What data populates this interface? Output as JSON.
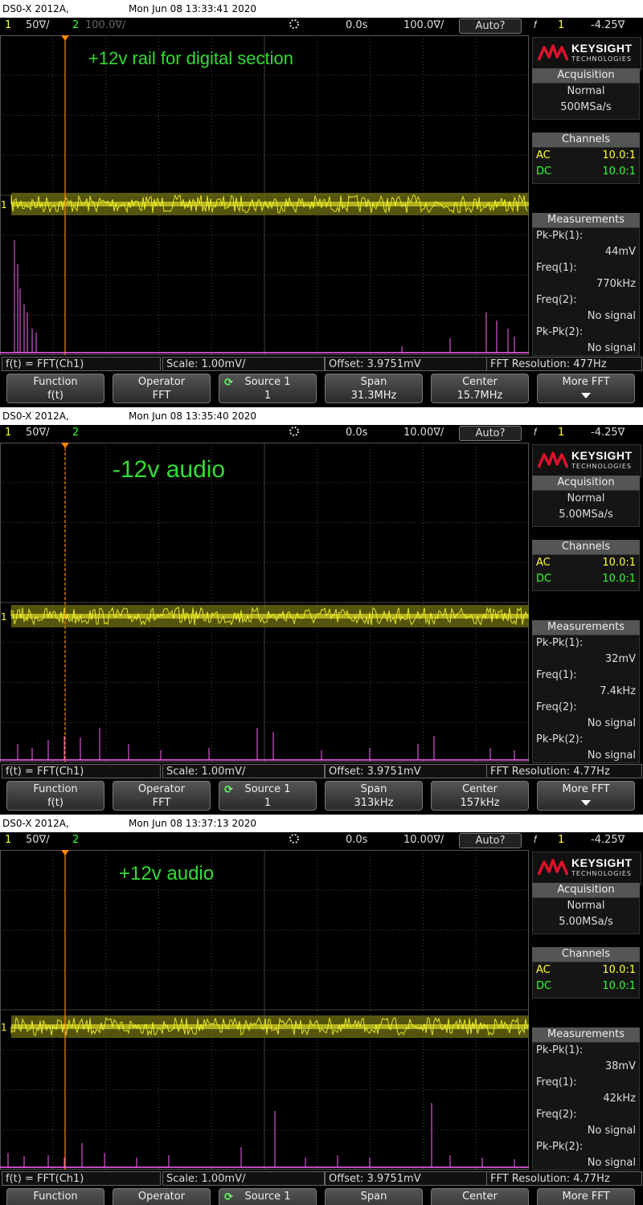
{
  "screens": [
    {
      "title_left": "DS0-X 2012A,",
      "title_date": "Mon Jun 08 13:33:41 2020",
      "ch1_num": "1",
      "ch1_scale": "50∇/",
      "ch2_num": "2",
      "ch2_scale": "100.0∇/",
      "time_delay": "0.0s",
      "time_scale": "100.0∇/",
      "trigger_mode": "Auto?",
      "trigger_src": "1",
      "trigger_level": "-4.25∇",
      "annotation": "+12v rail for digital section",
      "logo": {
        "name": "KEYSIGHT",
        "sub": "TECHNOLOGIES"
      },
      "acquisition": {
        "header": "Acquisition",
        "mode": "Normal",
        "rate": "500MSa/s"
      },
      "channels": {
        "header": "Channels",
        "ac_label": "AC",
        "ac_value": "10.0:1",
        "dc_label": "DC",
        "dc_value": "10.0:1"
      },
      "measurements": {
        "header": "Measurements",
        "items": [
          {
            "label": "Pk-Pk(1):",
            "value": "44mV"
          },
          {
            "label": "Freq(1):",
            "value": "770kHz"
          },
          {
            "label": "Freq(2):",
            "value": "No signal"
          },
          {
            "label": "Pk-Pk(2):",
            "value": "No signal"
          }
        ]
      },
      "info": {
        "func": "f(t) = FFT(Ch1)",
        "scale": "Scale: 1.00mV/",
        "offset": "Offset: 3.9751mV",
        "res": "FFT Resolution: 477Hz"
      },
      "softkeys": [
        {
          "title": "Function",
          "value": "f(t)"
        },
        {
          "title": "Operator",
          "value": "FFT"
        },
        {
          "title": "Source 1",
          "value": "1"
        },
        {
          "title": "Span",
          "value": "31.3MHz"
        },
        {
          "title": "Center",
          "value": "15.7MHz"
        },
        {
          "title": "More FFT",
          "value": ""
        }
      ]
    },
    {
      "title_left": "DS0-X 2012A,",
      "title_date": "Mon Jun 08 13:35:40 2020",
      "ch1_num": "1",
      "ch1_scale": "50∇/",
      "ch2_num": "2",
      "ch2_scale": "",
      "time_delay": "0.0s",
      "time_scale": "10.00∇/",
      "trigger_mode": "Auto?",
      "trigger_src": "1",
      "trigger_level": "-4.25∇",
      "annotation": "-12v audio",
      "logo": {
        "name": "KEYSIGHT",
        "sub": "TECHNOLOGIES"
      },
      "acquisition": {
        "header": "Acquisition",
        "mode": "Normal",
        "rate": "5.00MSa/s"
      },
      "channels": {
        "header": "Channels",
        "ac_label": "AC",
        "ac_value": "10.0:1",
        "dc_label": "DC",
        "dc_value": "10.0:1"
      },
      "measurements": {
        "header": "Measurements",
        "items": [
          {
            "label": "Pk-Pk(1):",
            "value": "32mV"
          },
          {
            "label": "Freq(1):",
            "value": "7.4kHz"
          },
          {
            "label": "Freq(2):",
            "value": "No signal"
          },
          {
            "label": "Pk-Pk(2):",
            "value": "No signal"
          }
        ]
      },
      "info": {
        "func": "f(t) = FFT(Ch1)",
        "scale": "Scale: 1.00mV/",
        "offset": "Offset: 3.9751mV",
        "res": "FFT Resolution: 4.77Hz"
      },
      "softkeys": [
        {
          "title": "Function",
          "value": "f(t)"
        },
        {
          "title": "Operator",
          "value": "FFT"
        },
        {
          "title": "Source 1",
          "value": "1"
        },
        {
          "title": "Span",
          "value": "313kHz"
        },
        {
          "title": "Center",
          "value": "157kHz"
        },
        {
          "title": "More FFT",
          "value": ""
        }
      ]
    },
    {
      "title_left": "DS0-X 2012A,",
      "title_date": "Mon Jun 08 13:37:13 2020",
      "ch1_num": "1",
      "ch1_scale": "50∇/",
      "ch2_num": "2",
      "ch2_scale": "",
      "time_delay": "0.0s",
      "time_scale": "10.00∇/",
      "trigger_mode": "Auto?",
      "trigger_src": "1",
      "trigger_level": "-4.25∇",
      "annotation": "+12v audio",
      "logo": {
        "name": "KEYSIGHT",
        "sub": "TECHNOLOGIES"
      },
      "acquisition": {
        "header": "Acquisition",
        "mode": "Normal",
        "rate": "5.00MSa/s"
      },
      "channels": {
        "header": "Channels",
        "ac_label": "AC",
        "ac_value": "10.0:1",
        "dc_label": "DC",
        "dc_value": "10.0:1"
      },
      "measurements": {
        "header": "Measurements",
        "items": [
          {
            "label": "Pk-Pk(1):",
            "value": "38mV"
          },
          {
            "label": "Freq(1):",
            "value": "42kHz"
          },
          {
            "label": "Freq(2):",
            "value": "No signal"
          },
          {
            "label": "Pk-Pk(2):",
            "value": "No signal"
          }
        ]
      },
      "info": {
        "func": "f(t) = FFT(Ch1)",
        "scale": "Scale: 1.00mV/",
        "offset": "Offset: 3.9751mV",
        "res": "FFT Resolution: 4.77Hz"
      },
      "softkeys": [
        {
          "title": "Function",
          "value": ""
        },
        {
          "title": "Operator",
          "value": ""
        },
        {
          "title": "Source 1",
          "value": ""
        },
        {
          "title": "Span",
          "value": ""
        },
        {
          "title": "Center",
          "value": ""
        },
        {
          "title": "More FFT",
          "value": ""
        }
      ]
    }
  ],
  "colors": {
    "ch1": "#ffff30",
    "ch2": "#30ff30",
    "fft": "#ff66ff",
    "cursor": "#ff8800",
    "annotation": "#33dd33"
  }
}
